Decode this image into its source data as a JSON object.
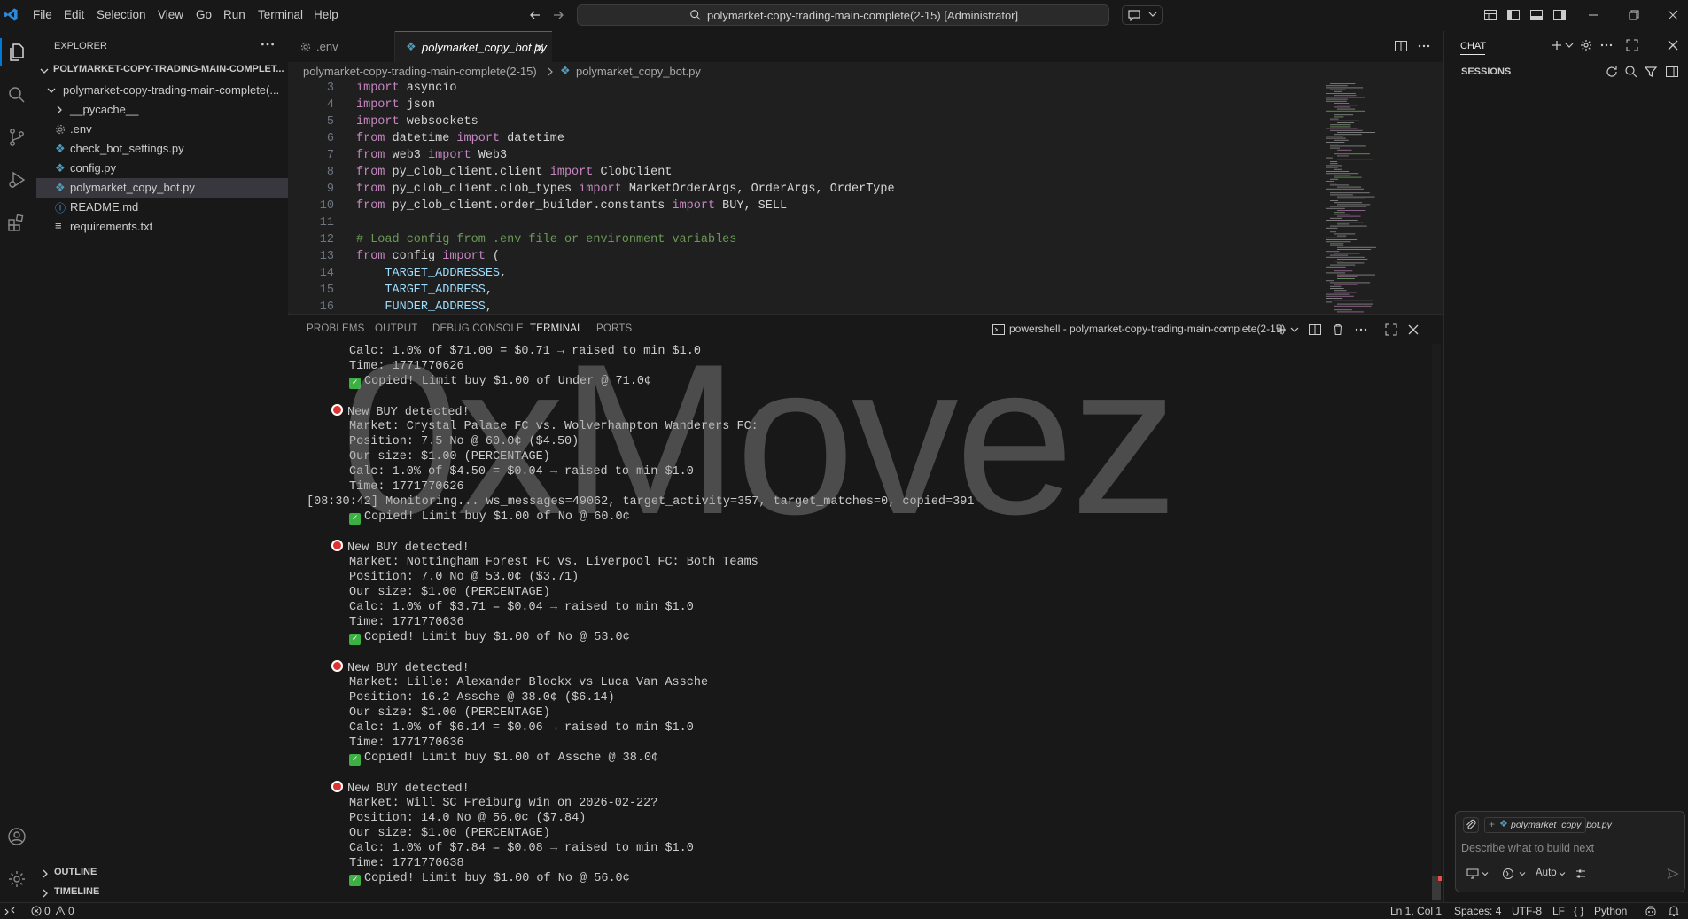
{
  "titlebar": {
    "menu": [
      "File",
      "Edit",
      "Selection",
      "View",
      "Go",
      "Run",
      "Terminal",
      "Help"
    ],
    "command_center": "polymarket-copy-trading-main-complete(2-15) [Administrator]"
  },
  "sidebar": {
    "header": "EXPLORER",
    "root": "POLYMARKET-COPY-TRADING-MAIN-COMPLET...",
    "folder": "polymarket-copy-trading-main-complete(...",
    "items": [
      "__pycache__",
      ".env",
      "check_bot_settings.py",
      "config.py",
      "polymarket_copy_bot.py",
      "README.md",
      "requirements.txt"
    ],
    "outline": "OUTLINE",
    "timeline": "TIMELINE"
  },
  "tabs": [
    {
      "label": ".env",
      "active": false
    },
    {
      "label": "polymarket_copy_bot.py",
      "active": true
    }
  ],
  "breadcrumb": {
    "folder": "polymarket-copy-trading-main-complete(2-15)",
    "file": "polymarket_copy_bot.py"
  },
  "editor": {
    "lines": [
      {
        "n": "3",
        "t": [
          [
            "kw",
            "import"
          ],
          [
            "pl",
            " asyncio"
          ]
        ]
      },
      {
        "n": "4",
        "t": [
          [
            "kw",
            "import"
          ],
          [
            "pl",
            " json"
          ]
        ]
      },
      {
        "n": "5",
        "t": [
          [
            "kw",
            "import"
          ],
          [
            "pl",
            " websockets"
          ]
        ]
      },
      {
        "n": "6",
        "t": [
          [
            "kw",
            "from"
          ],
          [
            "pl",
            " datetime "
          ],
          [
            "kw",
            "import"
          ],
          [
            "pl",
            " datetime"
          ]
        ]
      },
      {
        "n": "7",
        "t": [
          [
            "kw",
            "from"
          ],
          [
            "pl",
            " web3 "
          ],
          [
            "kw",
            "import"
          ],
          [
            "pl",
            " Web3"
          ]
        ]
      },
      {
        "n": "8",
        "t": [
          [
            "kw",
            "from"
          ],
          [
            "pl",
            " py_clob_client.client "
          ],
          [
            "kw",
            "import"
          ],
          [
            "pl",
            " ClobClient"
          ]
        ]
      },
      {
        "n": "9",
        "t": [
          [
            "kw",
            "from"
          ],
          [
            "pl",
            " py_clob_client.clob_types "
          ],
          [
            "kw",
            "import"
          ],
          [
            "pl",
            " MarketOrderArgs, OrderArgs, OrderType"
          ]
        ]
      },
      {
        "n": "10",
        "t": [
          [
            "kw",
            "from"
          ],
          [
            "pl",
            " py_clob_client.order_builder.constants "
          ],
          [
            "kw",
            "import"
          ],
          [
            "pl",
            " BUY, SELL"
          ]
        ]
      },
      {
        "n": "11",
        "t": []
      },
      {
        "n": "12",
        "t": [
          [
            "cm",
            "# Load config from .env file or environment variables"
          ]
        ]
      },
      {
        "n": "13",
        "t": [
          [
            "kw",
            "from"
          ],
          [
            "pl",
            " config "
          ],
          [
            "kw",
            "import"
          ],
          [
            "pl",
            " ("
          ]
        ]
      },
      {
        "n": "14",
        "t": [
          [
            "id",
            "    TARGET_ADDRESSES"
          ],
          [
            "pl",
            ","
          ]
        ]
      },
      {
        "n": "15",
        "t": [
          [
            "id",
            "    TARGET_ADDRESS"
          ],
          [
            "pl",
            ","
          ]
        ]
      },
      {
        "n": "16",
        "t": [
          [
            "id",
            "    FUNDER_ADDRESS"
          ],
          [
            "pl",
            ","
          ]
        ]
      }
    ]
  },
  "panel": {
    "tabs": [
      "PROBLEMS",
      "OUTPUT",
      "DEBUG CONSOLE",
      "TERMINAL",
      "PORTS"
    ],
    "active_tab": "TERMINAL",
    "shell_label": "powershell - polymarket-copy-trading-main-complete(2-15)"
  },
  "terminal": {
    "lines": [
      {
        "k": "i",
        "t": "Calc: 1.0% of $71.00 = $0.71 → raised to min $1.0"
      },
      {
        "k": "i",
        "t": "Time: 1771770626"
      },
      {
        "k": "c",
        "t": "Copied! Limit buy $1.00 of Under @ 71.0¢"
      },
      {
        "k": "b",
        "t": ""
      },
      {
        "k": "n",
        "t": "New BUY detected!"
      },
      {
        "k": "i",
        "t": "Market: Crystal Palace FC vs. Wolverhampton Wanderers FC:"
      },
      {
        "k": "i",
        "t": "Position: 7.5 No @ 60.0¢ ($4.50)"
      },
      {
        "k": "i",
        "t": "Our size: $1.00 (PERCENTAGE)"
      },
      {
        "k": "i",
        "t": "Calc: 1.0% of $4.50 = $0.04 → raised to min $1.0"
      },
      {
        "k": "i",
        "t": "Time: 1771770626"
      },
      {
        "k": "m",
        "t": "[08:30:42] Monitoring... ws_messages=49062, target_activity=357, target_matches=0, copied=391"
      },
      {
        "k": "c",
        "t": "Copied! Limit buy $1.00 of No @ 60.0¢"
      },
      {
        "k": "b",
        "t": ""
      },
      {
        "k": "n",
        "t": "New BUY detected!"
      },
      {
        "k": "i",
        "t": "Market: Nottingham Forest FC vs. Liverpool FC: Both Teams"
      },
      {
        "k": "i",
        "t": "Position: 7.0 No @ 53.0¢ ($3.71)"
      },
      {
        "k": "i",
        "t": "Our size: $1.00 (PERCENTAGE)"
      },
      {
        "k": "i",
        "t": "Calc: 1.0% of $3.71 = $0.04 → raised to min $1.0"
      },
      {
        "k": "i",
        "t": "Time: 1771770636"
      },
      {
        "k": "c",
        "t": "Copied! Limit buy $1.00 of No @ 53.0¢"
      },
      {
        "k": "b",
        "t": ""
      },
      {
        "k": "n",
        "t": "New BUY detected!"
      },
      {
        "k": "i",
        "t": "Market: Lille: Alexander Blockx vs Luca Van Assche"
      },
      {
        "k": "i",
        "t": "Position: 16.2 Assche @ 38.0¢ ($6.14)"
      },
      {
        "k": "i",
        "t": "Our size: $1.00 (PERCENTAGE)"
      },
      {
        "k": "i",
        "t": "Calc: 1.0% of $6.14 = $0.06 → raised to min $1.0"
      },
      {
        "k": "i",
        "t": "Time: 1771770636"
      },
      {
        "k": "c",
        "t": "Copied! Limit buy $1.00 of Assche @ 38.0¢"
      },
      {
        "k": "b",
        "t": ""
      },
      {
        "k": "n",
        "t": "New BUY detected!"
      },
      {
        "k": "i",
        "t": "Market: Will SC Freiburg win on 2026-02-22?"
      },
      {
        "k": "i",
        "t": "Position: 14.0 No @ 56.0¢ ($7.84)"
      },
      {
        "k": "i",
        "t": "Our size: $1.00 (PERCENTAGE)"
      },
      {
        "k": "i",
        "t": "Calc: 1.0% of $7.84 = $0.08 → raised to min $1.0"
      },
      {
        "k": "i",
        "t": "Time: 1771770638"
      },
      {
        "k": "c",
        "t": "Copied! Limit buy $1.00 of No @ 56.0¢"
      }
    ]
  },
  "watermark": "0xMovez",
  "chat": {
    "title": "CHAT",
    "sessions": "SESSIONS",
    "context_file": "polymarket_copy_bot.py",
    "placeholder": "Describe what to build next",
    "mode": "Auto"
  },
  "statusbar": {
    "errors": "0",
    "warnings": "0",
    "position": "Ln 1, Col 1",
    "spaces": "Spaces: 4",
    "encoding": "UTF-8",
    "eol": "LF",
    "language": "Python"
  },
  "colors": {
    "accent": "#0078d4",
    "keyword": "#c586c0",
    "comment": "#6a9955",
    "identifier": "#9cdcfe",
    "python_icon": "#519aba"
  }
}
